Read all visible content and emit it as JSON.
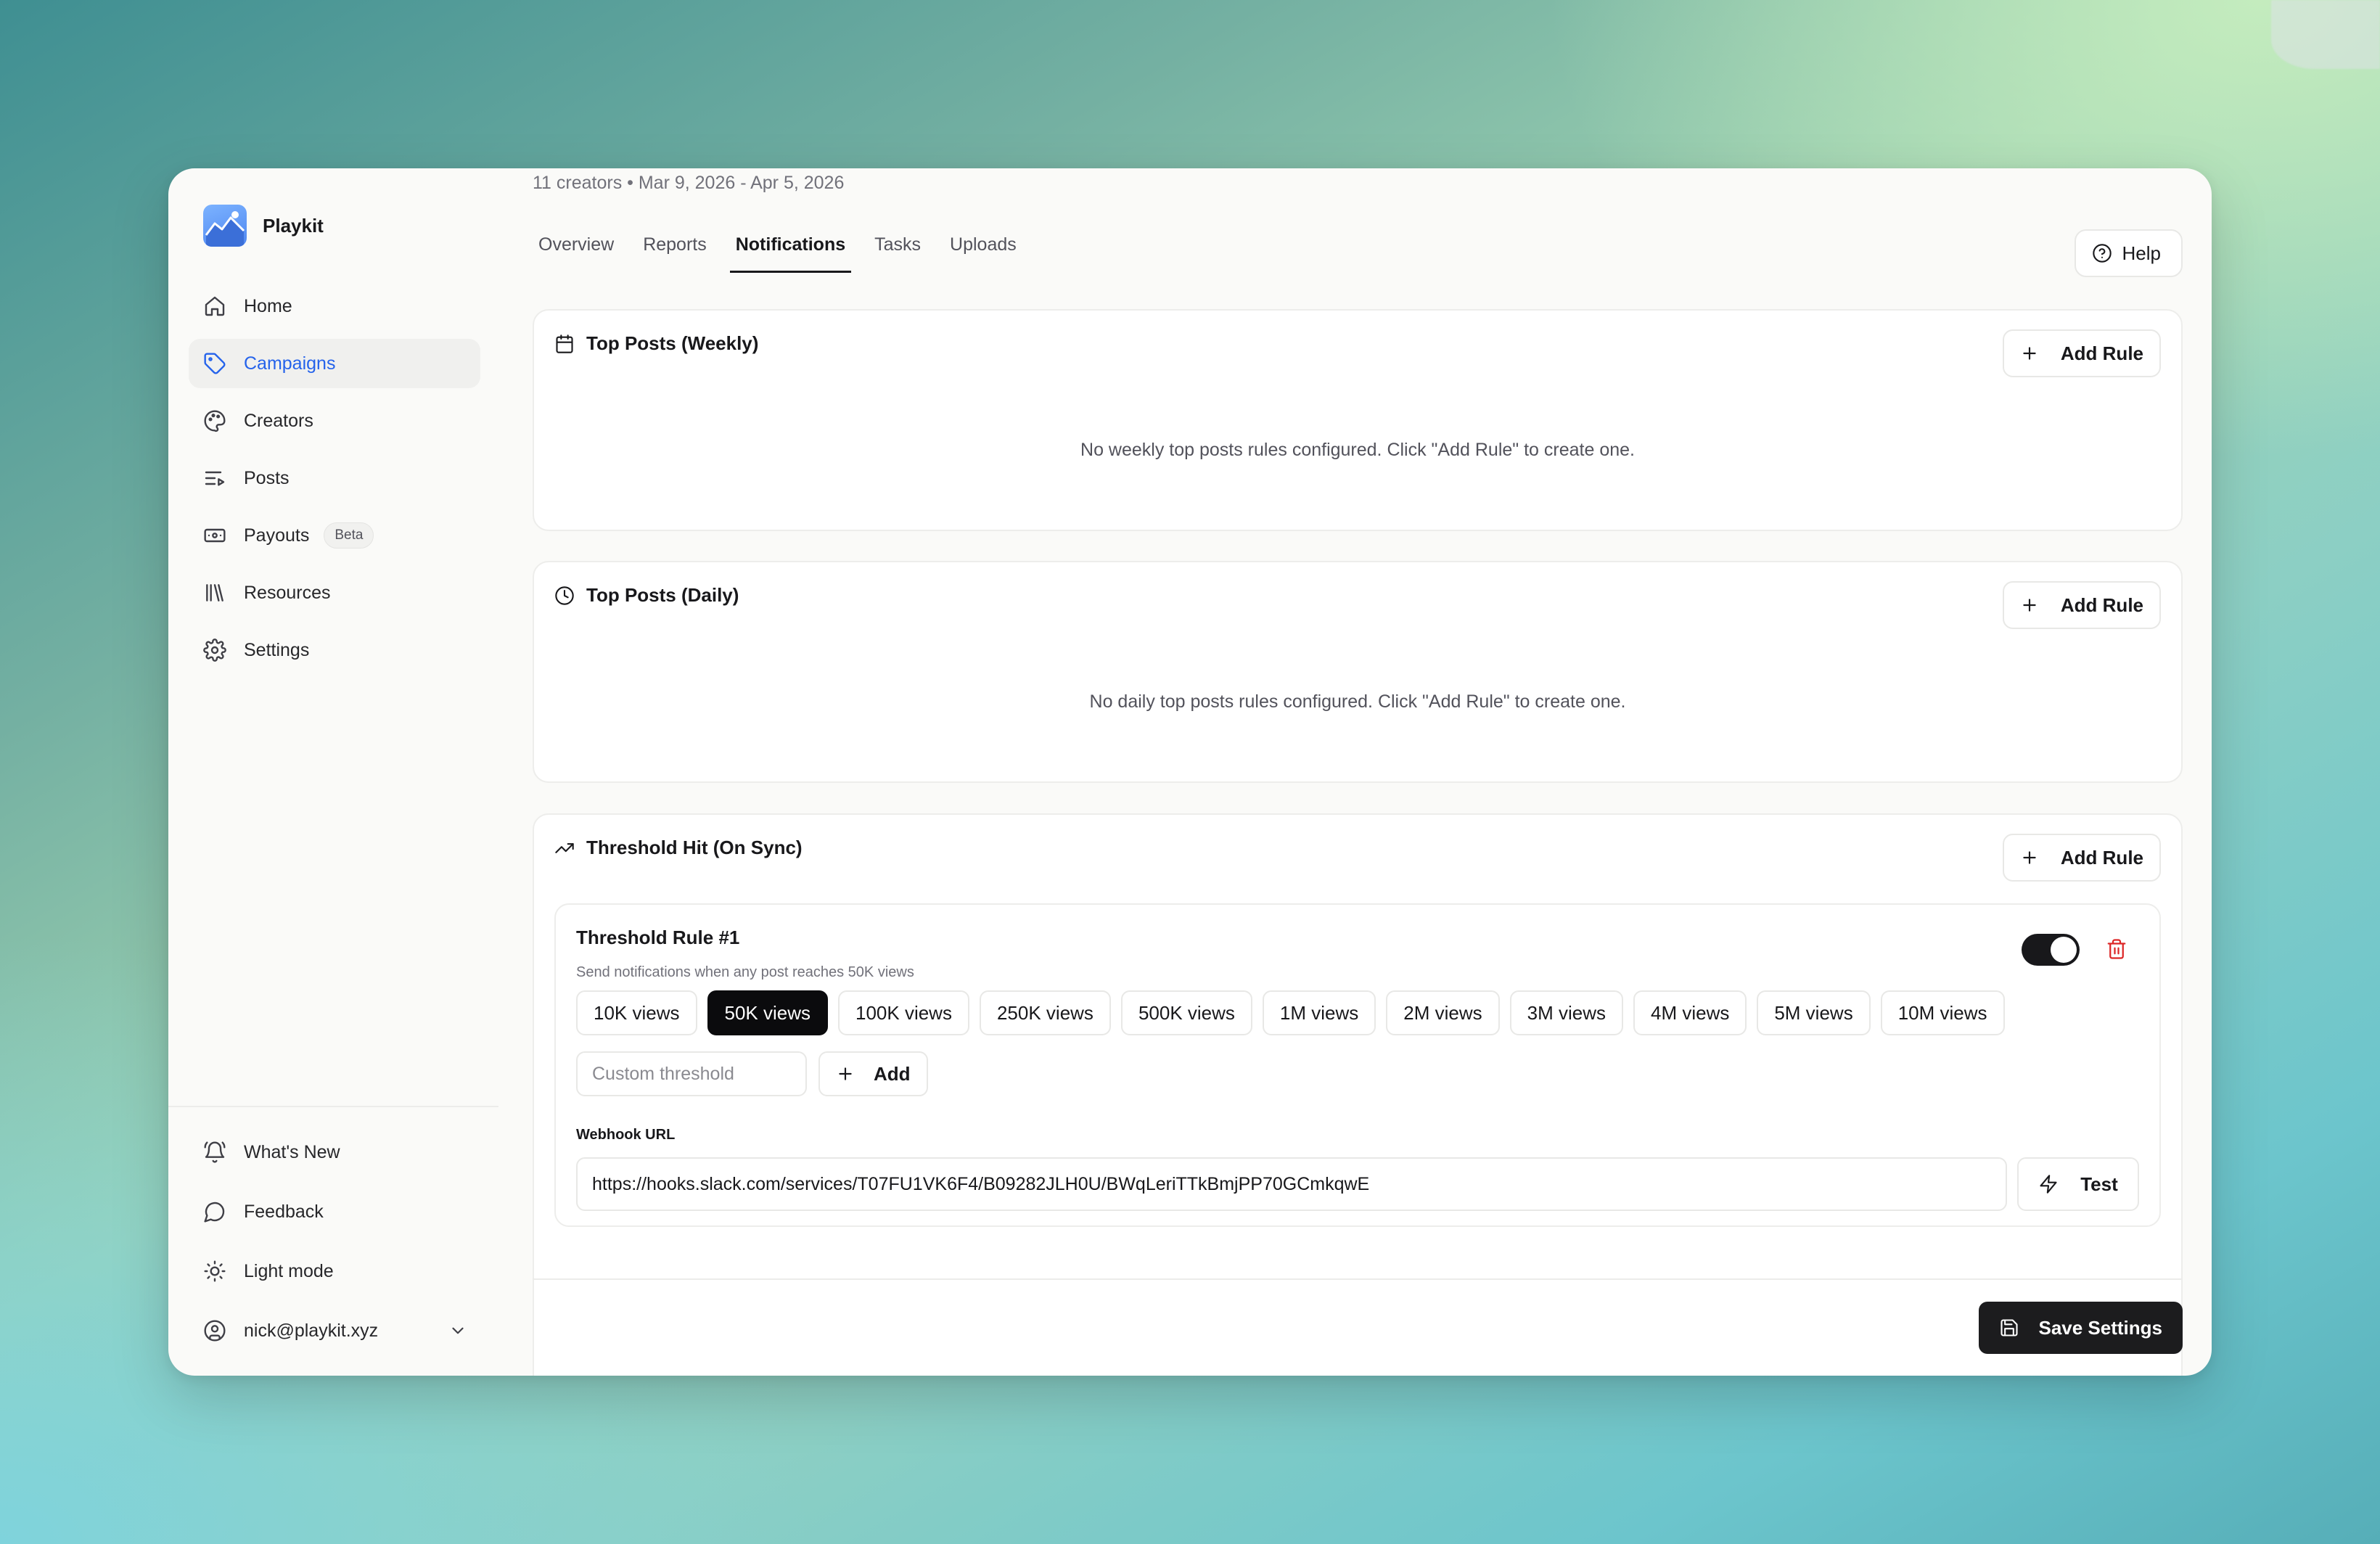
{
  "app": {
    "name": "Playkit"
  },
  "sidebar": {
    "items": [
      {
        "label": "Home",
        "icon": "home-icon"
      },
      {
        "label": "Campaigns",
        "icon": "tag-icon",
        "active": true
      },
      {
        "label": "Creators",
        "icon": "palette-icon"
      },
      {
        "label": "Posts",
        "icon": "list-play-icon"
      },
      {
        "label": "Payouts",
        "icon": "banknote-icon",
        "badge": "Beta"
      },
      {
        "label": "Resources",
        "icon": "library-icon"
      },
      {
        "label": "Settings",
        "icon": "gear-icon"
      }
    ],
    "bottom": [
      {
        "label": "What's New",
        "icon": "bell-ring-icon"
      },
      {
        "label": "Feedback",
        "icon": "message-circle-icon"
      },
      {
        "label": "Light mode",
        "icon": "sun-icon"
      }
    ],
    "user": {
      "email": "nick@playkit.xyz"
    }
  },
  "header": {
    "subtitle": "11 creators • Mar 9, 2026 - Apr 5, 2026",
    "tabs": [
      "Overview",
      "Reports",
      "Notifications",
      "Tasks",
      "Uploads"
    ],
    "active_tab": "Notifications",
    "help_label": "Help"
  },
  "sections": {
    "weekly": {
      "title": "Top Posts (Weekly)",
      "add_label": "Add Rule",
      "empty": "No weekly top posts rules configured. Click \"Add Rule\" to create one."
    },
    "daily": {
      "title": "Top Posts (Daily)",
      "add_label": "Add Rule",
      "empty": "No daily top posts rules configured. Click \"Add Rule\" to create one."
    },
    "threshold": {
      "title": "Threshold Hit (On Sync)",
      "add_label": "Add Rule",
      "rule": {
        "title": "Threshold Rule #1",
        "description": "Send notifications when any post reaches 50K views",
        "enabled": true,
        "options": [
          "10K views",
          "50K views",
          "100K views",
          "250K views",
          "500K views",
          "1M views",
          "2M views",
          "3M views",
          "4M views",
          "5M views",
          "10M views"
        ],
        "selected": "50K views",
        "custom_placeholder": "Custom threshold",
        "custom_add_label": "Add",
        "webhook_label": "Webhook URL",
        "webhook_value": "https://hooks.slack.com/services/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",
        "test_label": "Test"
      }
    }
  },
  "footer": {
    "save_label": "Save Settings"
  },
  "colors": {
    "accent": "#2563eb",
    "primary": "#18181b",
    "danger": "#dc2626"
  }
}
